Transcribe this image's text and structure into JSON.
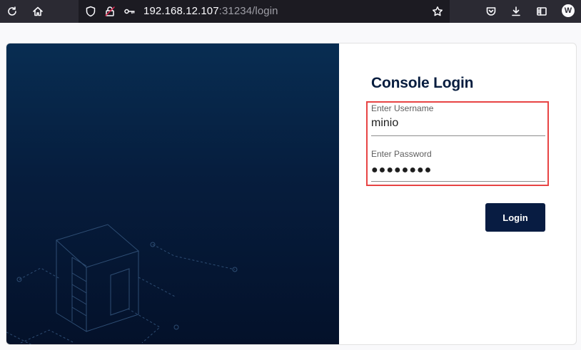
{
  "browser": {
    "url_host": "192.168.12.107",
    "url_rest": ":31234/login",
    "profile_initial": "W"
  },
  "login": {
    "title": "Console Login",
    "username_label": "Enter Username",
    "username_value": "minio",
    "password_label": "Enter Password",
    "password_masked": "●●●●●●●●",
    "button_label": "Login"
  },
  "colors": {
    "toolbar": "#2b2a33",
    "hero_top": "#082d52",
    "hero_bottom": "#04112a",
    "button": "#081c42",
    "highlight": "#e84444"
  }
}
